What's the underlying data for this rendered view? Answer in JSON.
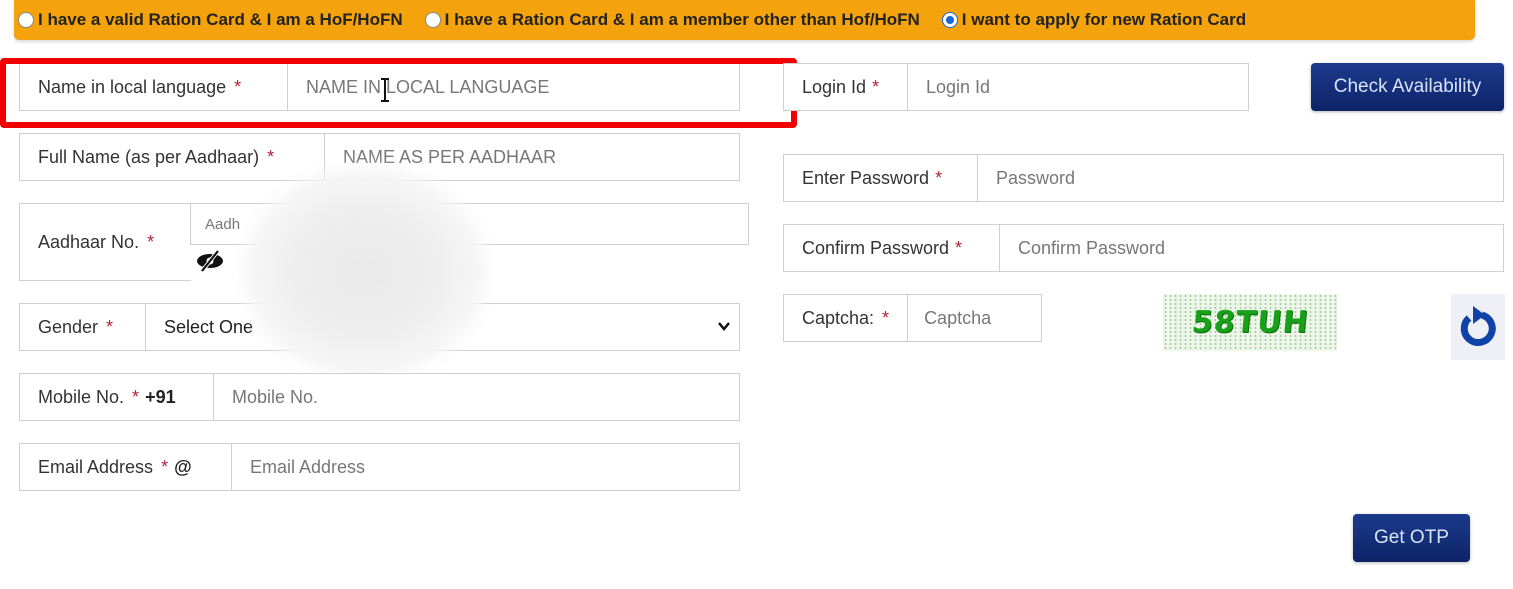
{
  "applicant_type": {
    "options": [
      {
        "label": "I have a valid Ration Card & I am a HoF/HoFN",
        "selected": false
      },
      {
        "label": "I have a Ration Card & I am a member other than Hof/HoFN",
        "selected": false
      },
      {
        "label": "I want to apply for new Ration Card",
        "selected": true
      }
    ]
  },
  "left_form": {
    "name_local": {
      "label": "Name in local language",
      "required": "*",
      "placeholder": "NAME IN LOCAL LANGUAGE",
      "value": ""
    },
    "full_name": {
      "label": "Full Name (as per Aadhaar)",
      "required": "*",
      "placeholder": "NAME AS PER AADHAAR",
      "value": ""
    },
    "aadhaar": {
      "label": "Aadhaar No.",
      "required": "*",
      "placeholder": "Aadh",
      "value": "",
      "toggle_icon": "eye-slash-icon"
    },
    "gender": {
      "label": "Gender",
      "required": "*",
      "selected": "Select One"
    },
    "mobile": {
      "label": "Mobile No.",
      "required": "*",
      "prefix": "+91",
      "placeholder": "Mobile No.",
      "value": ""
    },
    "email": {
      "label": "Email Address",
      "required": "*",
      "prefix": "@",
      "placeholder": "Email Address",
      "value": ""
    }
  },
  "right_form": {
    "login_id": {
      "label": "Login Id",
      "required": "*",
      "placeholder": "Login Id",
      "value": ""
    },
    "check_availability_label": "Check Availability",
    "password": {
      "label": "Enter Password",
      "required": "*",
      "placeholder": "Password",
      "value": ""
    },
    "confirm_password": {
      "label": "Confirm Password",
      "required": "*",
      "placeholder": "Confirm Password",
      "value": ""
    },
    "captcha": {
      "label": "Captcha:",
      "required": "*",
      "placeholder": "Captcha",
      "value": "",
      "image_text": "58TUH",
      "refresh_icon": "refresh-icon"
    },
    "get_otp_label": "Get OTP"
  },
  "colors": {
    "radio_bar": "#f5a30c",
    "primary_button": "#132e7a",
    "highlight": "#f20000",
    "required_star": "#b0243a"
  }
}
